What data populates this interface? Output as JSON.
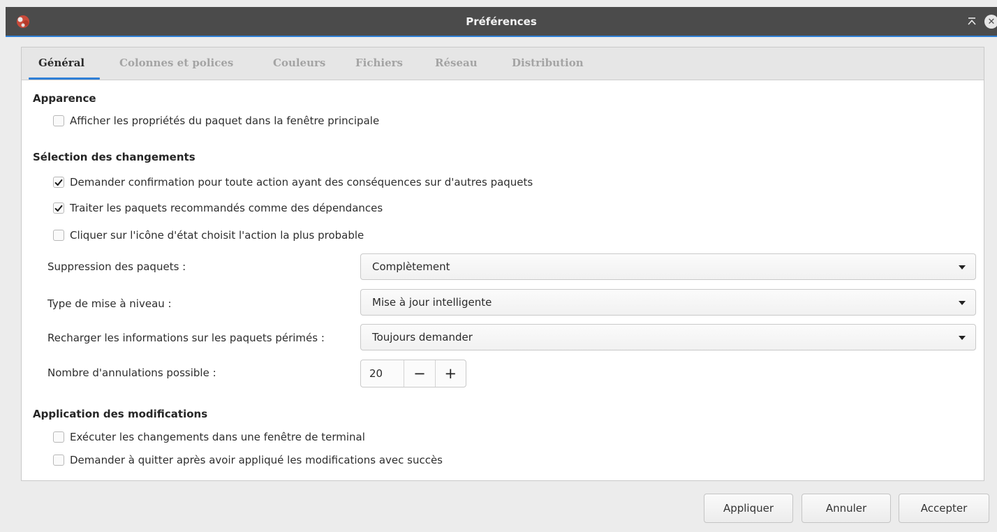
{
  "window": {
    "title": "Préférences"
  },
  "tabs": [
    {
      "label": "Général",
      "active": true
    },
    {
      "label": "Colonnes et polices",
      "active": false
    },
    {
      "label": "Couleurs",
      "active": false
    },
    {
      "label": "Fichiers",
      "active": false
    },
    {
      "label": "Réseau",
      "active": false
    },
    {
      "label": "Distribution",
      "active": false
    }
  ],
  "appearance": {
    "title": "Apparence",
    "show_properties": {
      "label": "Afficher les propriétés du paquet dans la fenêtre principale",
      "checked": false
    }
  },
  "selection": {
    "title": "Sélection des changements",
    "ask_confirmation": {
      "label": "Demander confirmation pour toute action ayant des conséquences sur d'autres paquets",
      "checked": true
    },
    "treat_recommended": {
      "label": "Traiter les paquets recommandés comme des dépendances",
      "checked": true
    },
    "click_status_icon": {
      "label": "Cliquer sur l'icône d'état choisit l'action la plus probable",
      "checked": false
    },
    "removal": {
      "label": "Suppression des paquets :",
      "value": "Complètement"
    },
    "upgrade_type": {
      "label": "Type de mise à niveau :",
      "value": "Mise à jour intelligente"
    },
    "reload_outdated": {
      "label": "Recharger les informations sur les paquets périmés :",
      "value": "Toujours demander"
    },
    "undo_count": {
      "label": "Nombre d'annulations possible :",
      "value": "20",
      "minus": "−",
      "plus": "+"
    }
  },
  "apply": {
    "title": "Application des modifications",
    "run_in_terminal": {
      "label": "Exécuter les changements dans une fenêtre de terminal",
      "checked": false
    },
    "ask_quit": {
      "label": "Demander à quitter après avoir appliqué les modifications avec succès",
      "checked": false
    }
  },
  "buttons": {
    "apply": "Appliquer",
    "cancel": "Annuler",
    "accept": "Accepter"
  },
  "colors": {
    "accent": "#2f7fd6",
    "titlebar": "#4b4b4b"
  },
  "icons": {
    "app": "synaptic-app-icon",
    "shade": "shade-icon",
    "close": "close-icon",
    "check": "check-icon",
    "dropdown": "chevron-down-icon"
  }
}
